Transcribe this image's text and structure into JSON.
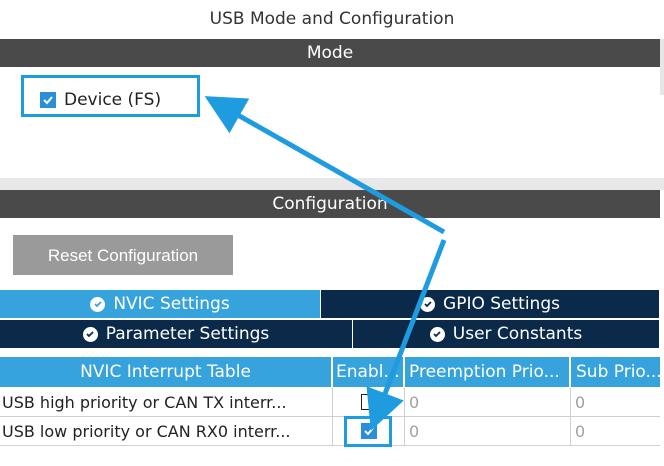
{
  "window": {
    "title": "USB Mode and Configuration"
  },
  "mode": {
    "header": "Mode",
    "device_label": "Device (FS)",
    "device_checked": true
  },
  "configuration": {
    "header": "Configuration",
    "reset_label": "Reset Configuration",
    "tabs": [
      {
        "label": "NVIC Settings",
        "active": true
      },
      {
        "label": "GPIO Settings",
        "active": false
      },
      {
        "label": "Parameter Settings",
        "active": false
      },
      {
        "label": "User Constants",
        "active": false
      }
    ]
  },
  "nvic_table": {
    "headers": [
      "NVIC Interrupt Table",
      "Enabl...",
      "Preemption Prio...",
      "Sub Prio..."
    ],
    "rows": [
      {
        "name": "USB high priority or CAN TX interr...",
        "enabled": false,
        "preemption": "0",
        "sub": "0"
      },
      {
        "name": "USB low priority or CAN RX0 interr...",
        "enabled": true,
        "preemption": "0",
        "sub": "0"
      }
    ]
  },
  "colors": {
    "accent": "#37a3dc",
    "highlight": "#1f9be0",
    "header_bar": "#4a4a4a",
    "tab_inactive": "#0b2a4a",
    "reset_button": "#9a9a9a"
  },
  "icons": [
    "checkbox-checked-icon",
    "checkbox-unchecked-icon",
    "check-circle-icon",
    "arrow-icon"
  ]
}
